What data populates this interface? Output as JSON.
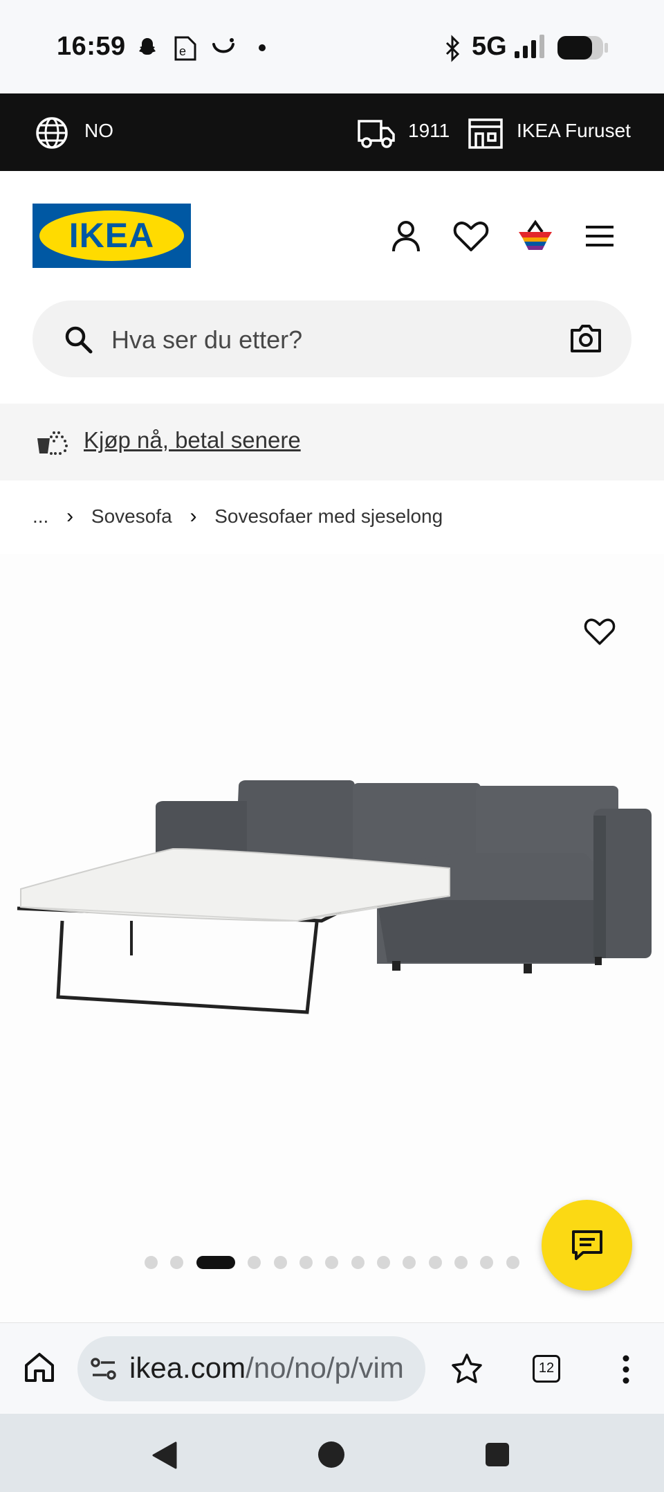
{
  "status_bar": {
    "time": "16:59",
    "network": "5G"
  },
  "top_bar": {
    "country": "NO",
    "delivery_label": "1911",
    "store_label": "IKEA Furuset"
  },
  "header": {
    "logo_text": "IKEA",
    "icons": [
      "user-icon",
      "heart-icon",
      "basket-icon",
      "menu-icon"
    ]
  },
  "search": {
    "placeholder": "Hva ser du etter?"
  },
  "banner": {
    "text": "Kjøp nå, betal senere"
  },
  "breadcrumb": {
    "items": [
      "...",
      "Sovesofa",
      "Sovesofaer med sjeselong"
    ]
  },
  "gallery": {
    "image_count": 14,
    "active_index": 2
  },
  "browser": {
    "url_host": "ikea.com",
    "url_path": "/no/no/p/vim",
    "tab_count": "12"
  },
  "colors": {
    "ikea_blue": "#0058a3",
    "ikea_yellow": "#ffdb00",
    "chat_button": "#fbd914",
    "top_bar": "#111111"
  }
}
